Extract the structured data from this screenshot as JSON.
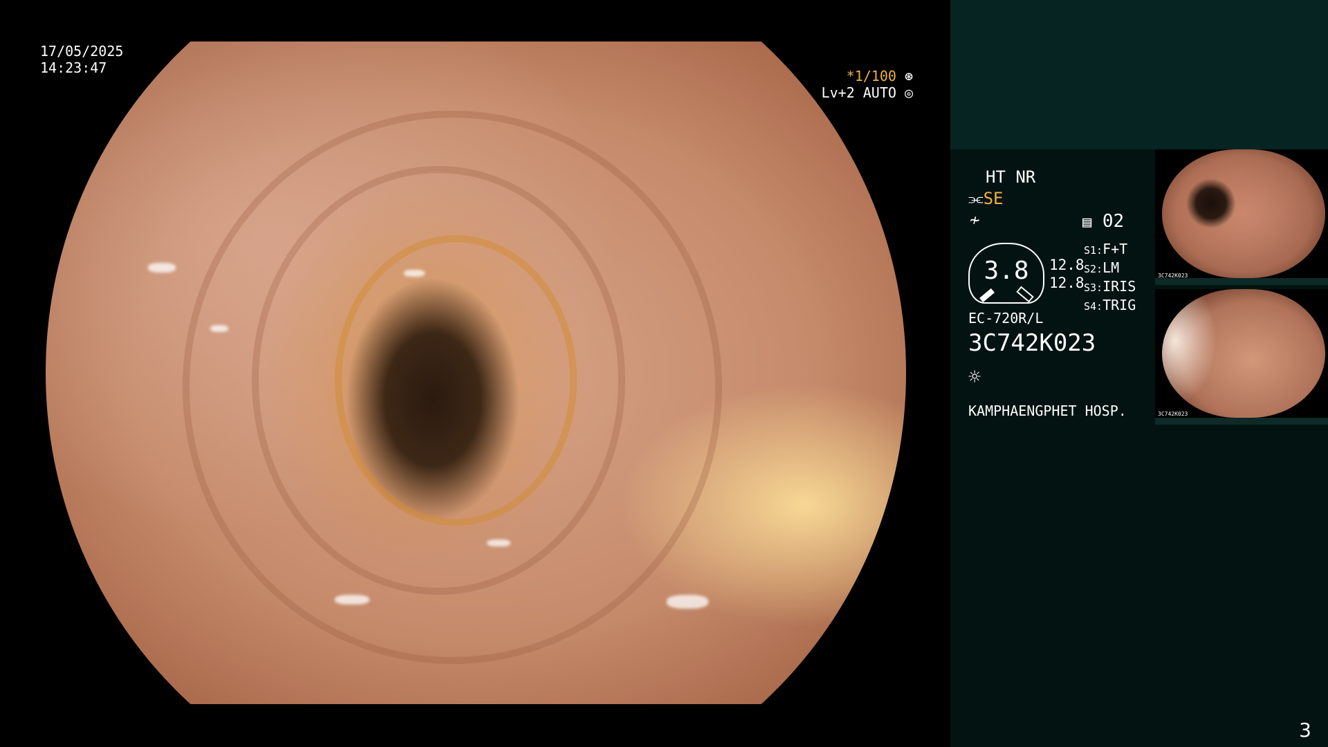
{
  "overlay": {
    "date": "17/05/2025",
    "time": "14:23:47",
    "shutter_value": "*1/100",
    "shutter_icon": "aperture-icon",
    "level_value": "Lv+2 AUTO",
    "level_icon": "auto-iris-icon"
  },
  "side_panel": {
    "mode_line": "HT NR",
    "se_icon": "enhancement-icon",
    "se_label": "SE",
    "color_icon": "color-curve-icon",
    "memory_icon": "memory-icon",
    "memory_value": "02",
    "gauge_value": "3.8",
    "gauge_left_a": "12.8",
    "gauge_left_b": "12.8",
    "switches": [
      {
        "key": "S1:",
        "value": "F+T"
      },
      {
        "key": "S2:",
        "value": "LM"
      },
      {
        "key": "S3:",
        "value": "IRIS"
      },
      {
        "key": "S4:",
        "value": "TRIG"
      }
    ],
    "scope_model": "EC-720R/L",
    "scope_serial": "3C742K023",
    "light_icon": "light-source-icon",
    "hospital": "KAMPHAENGPHET HOSP."
  },
  "thumbnails": [
    {
      "caption": "3C742K023"
    },
    {
      "caption": "3C742K023"
    }
  ],
  "page_number": "3",
  "colors": {
    "accent": "#f0b040",
    "panel_bg": "#031311",
    "panel_top": "#062421"
  }
}
